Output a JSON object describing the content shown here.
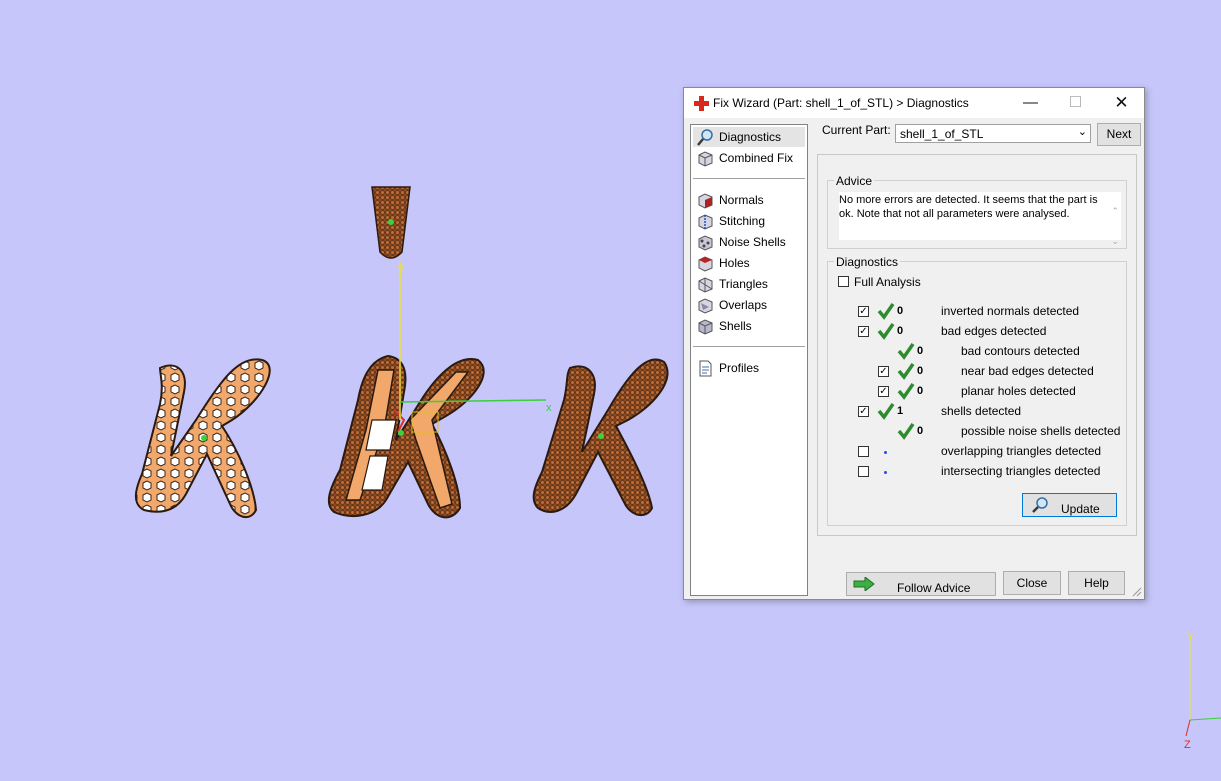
{
  "window": {
    "title": "Fix Wizard (Part: shell_1_of_STL) > Diagnostics",
    "minimize": "—",
    "maximize": "☐",
    "close": "✕"
  },
  "nav": {
    "items": [
      {
        "label": "Diagnostics",
        "icon": "magnifier-icon",
        "selected": true
      },
      {
        "label": "Combined Fix",
        "icon": "combined-fix-icon"
      },
      {
        "label": "Normals",
        "icon": "normals-icon"
      },
      {
        "label": "Stitching",
        "icon": "stitching-icon"
      },
      {
        "label": "Noise Shells",
        "icon": "noise-shells-icon"
      },
      {
        "label": "Holes",
        "icon": "holes-icon"
      },
      {
        "label": "Triangles",
        "icon": "triangles-icon"
      },
      {
        "label": "Overlaps",
        "icon": "overlaps-icon"
      },
      {
        "label": "Shells",
        "icon": "shells-icon"
      },
      {
        "label": "Profiles",
        "icon": "profiles-icon"
      }
    ]
  },
  "part": {
    "label": "Current Part:",
    "value": "shell_1_of_STL",
    "next": "Next"
  },
  "advice": {
    "title": "Advice",
    "text": "No more errors are detected. It seems that the part is ok. Note that not all parameters were analysed."
  },
  "diagnostics": {
    "title": "Diagnostics",
    "full_analysis": "Full Analysis",
    "rows": [
      {
        "checked": true,
        "ok": true,
        "count": "0",
        "label": "inverted normals detected"
      },
      {
        "checked": true,
        "ok": true,
        "count": "0",
        "label": "bad edges detected"
      },
      {
        "checked": null,
        "ok": true,
        "count": "0",
        "label": "bad contours detected"
      },
      {
        "checked": true,
        "ok": true,
        "count": "0",
        "label": "near bad edges detected"
      },
      {
        "checked": true,
        "ok": true,
        "count": "0",
        "label": "planar holes detected"
      },
      {
        "checked": true,
        "ok": true,
        "count": "1",
        "label": "shells detected"
      },
      {
        "checked": null,
        "ok": true,
        "count": "0",
        "label": "possible noise shells detected"
      },
      {
        "checked": false,
        "ok": false,
        "count": "",
        "label": "overlapping triangles detected"
      },
      {
        "checked": false,
        "ok": false,
        "count": "",
        "label": "intersecting triangles detected"
      }
    ],
    "update": "Update"
  },
  "buttons": {
    "follow_advice": "Follow Advice",
    "close": "Close",
    "help": "Help"
  },
  "viewport": {
    "axis_x": "x",
    "axis_y": "y",
    "corner_axis_y": "Y",
    "corner_axis_z": "Z"
  },
  "colors": {
    "background": "#c6c6fa",
    "part_fill": "#f2a86a",
    "dark_part": "#a6582c",
    "check_green": "#2e8b2e"
  }
}
